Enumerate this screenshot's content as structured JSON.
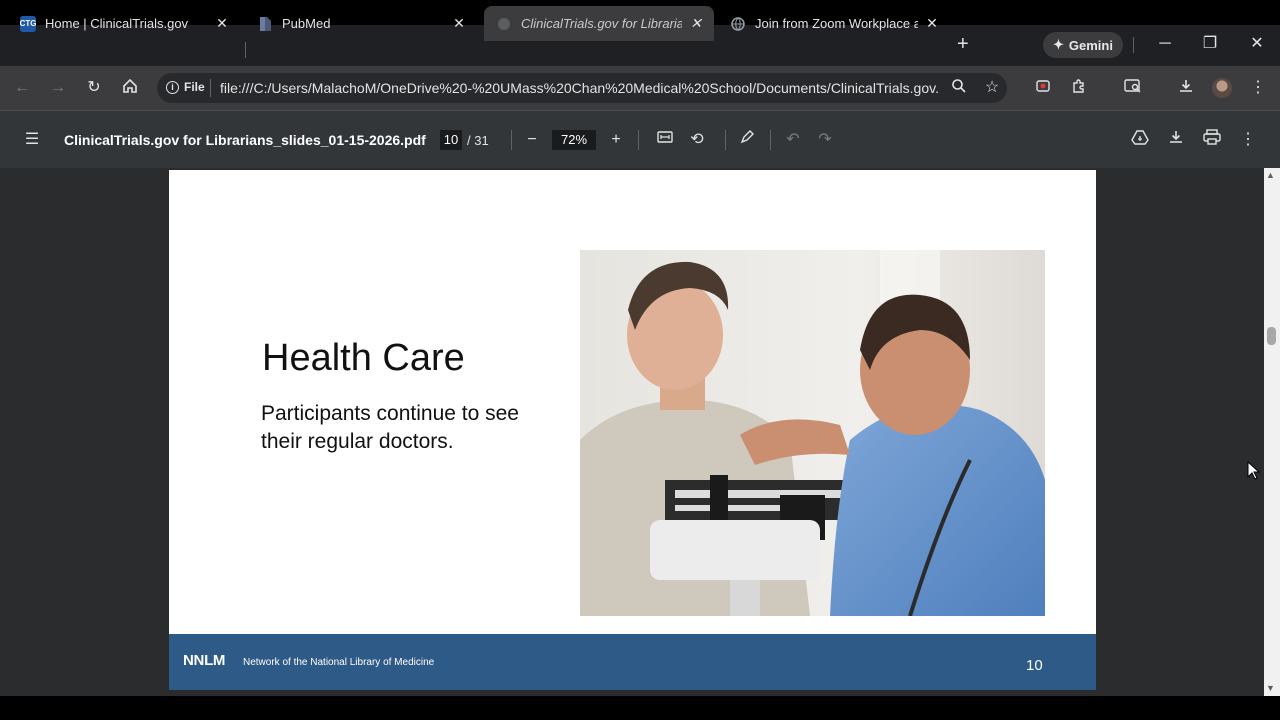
{
  "browser": {
    "tabs": [
      {
        "favicon": "CTG",
        "title": "Home | ClinicalTrials.gov",
        "active": false
      },
      {
        "favicon": "pubmed-icon",
        "title": "PubMed",
        "active": false
      },
      {
        "favicon": "loading-icon",
        "title": "ClinicalTrials.gov for Librarians",
        "active": true
      },
      {
        "favicon": "globe-icon",
        "title": "Join from Zoom Workplace app",
        "active": false
      }
    ],
    "new_tab": "+",
    "gemini_label": "Gemini",
    "window_controls": [
      "minimize",
      "restore",
      "close"
    ]
  },
  "toolbar": {
    "scheme_label": "File",
    "url": "file:///C:/Users/MalachoM/OneDrive%20-%20UMass%20Chan%20Medical%20School/Documents/ClinicalTrials.gov..."
  },
  "pdf": {
    "filename": "ClinicalTrials.gov for Librarians_slides_01-15-2026.pdf",
    "current_page": "10",
    "total_pages": "/ 31",
    "zoom": "72%"
  },
  "slide": {
    "title": "Health Care",
    "body": "Participants continue to see their regular doctors.",
    "footer_logo": "NNLM",
    "footer_text": "Network of the National Library of Medicine",
    "page_number": "10"
  },
  "colors": {
    "footer_bg": "#2e5a87",
    "chrome_bg": "#3c3c3e",
    "pdf_toolbar_bg": "#323639"
  }
}
